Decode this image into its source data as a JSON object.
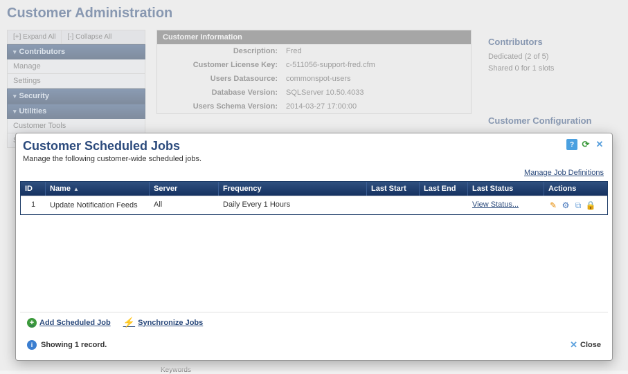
{
  "page": {
    "title": "Customer Administration"
  },
  "sidebar": {
    "expand_all": "[+] Expand All",
    "collapse_all": "[-] Collapse All",
    "sections": [
      {
        "header": "Contributors",
        "items": [
          "Manage",
          "Settings"
        ]
      },
      {
        "header": "Security",
        "items": []
      },
      {
        "header": "Utilities",
        "items": [
          "Customer Tools",
          "Scheduled Jobs"
        ]
      }
    ]
  },
  "info_panel": {
    "title": "Customer Information",
    "rows": [
      {
        "label": "Description:",
        "value": "Fred"
      },
      {
        "label": "Customer License Key:",
        "value": "c-511056-support-fred.cfm"
      },
      {
        "label": "Users Datasource:",
        "value": "commonspot-users"
      },
      {
        "label": "Database Version:",
        "value": "SQLServer 10.50.4033"
      },
      {
        "label": "Users Schema Version:",
        "value": "2014-03-27 17:00:00"
      }
    ]
  },
  "side_boxes": {
    "contributors": {
      "title": "Contributors",
      "line1": "Dedicated (2 of 5)",
      "line2": "Shared 0 for 1 slots"
    },
    "config": {
      "title": "Customer Configuration"
    }
  },
  "modal": {
    "title": "Customer Scheduled Jobs",
    "subtitle": "Manage the following customer-wide scheduled jobs.",
    "manage_defs": "Manage Job Definitions",
    "columns": {
      "id": "ID",
      "name": "Name",
      "server": "Server",
      "frequency": "Frequency",
      "last_start": "Last Start",
      "last_end": "Last End",
      "last_status": "Last Status",
      "actions": "Actions"
    },
    "sort_indicator": "▲",
    "rows": [
      {
        "id": "1",
        "name": "Update Notification Feeds",
        "server": "All",
        "frequency": "Daily Every 1 Hours",
        "last_start": "",
        "last_end": "",
        "last_status": "View Status...",
        "actions": ""
      }
    ],
    "footer_links": {
      "add": "Add Scheduled Job",
      "sync": "Synchronize Jobs"
    },
    "status_text": "Showing 1 record.",
    "close_label": "Close"
  },
  "icons": {
    "help": "?",
    "refresh": "⟳",
    "close_x": "✕",
    "add_plus": "+",
    "sync_bolt": "⚡",
    "info_i": "i",
    "edit": "✎",
    "gear": "⚙",
    "copy": "⧉",
    "lock": "🔒"
  },
  "bkg_partial": "Keywords"
}
